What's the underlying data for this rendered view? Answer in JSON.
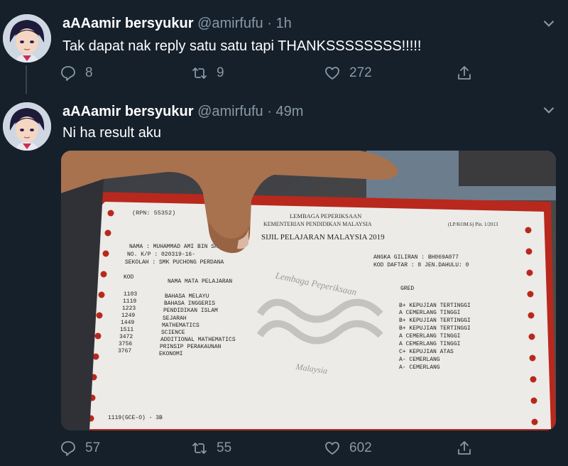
{
  "tweets": [
    {
      "name": "aAAamir bersyukur",
      "handle": "@amirfufu",
      "sep": "·",
      "time": "1h",
      "text": "Tak dapat nak reply satu satu tapi THANKSSSSSSSS!!!!!",
      "replies": "8",
      "retweets": "9",
      "likes": "272"
    },
    {
      "name": "aAAamir bersyukur",
      "handle": "@amirfufu",
      "sep": "·",
      "time": "49m",
      "text": "Ni ha result aku",
      "replies": "57",
      "retweets": "55",
      "likes": "602"
    }
  ],
  "slip": {
    "rpn": "(RPN: 55352)",
    "org1": "LEMBAGA PEPERIKSAAN",
    "org2": "KEMENTERIAN PENDIDIKAN MALAYSIA",
    "form": "(LP/KOM.6) Pin. 1/2013",
    "title": "SIJIL PELAJARAN MALAYSIA 2019",
    "nama": "NAMA   :  MUHAMMAD AMI          BIN SHAHARUDIN",
    "kp": "NO. K/P :  020319-16-",
    "sekolah": "SEKOLAH :  SMK PUCHONG PERDANA",
    "angka": "ANGKA GILIRAN  :  BH069A077",
    "daftar": "KOD DAFTAR  :  8 JEN.DAHULU:  0",
    "col_kod": "KOD",
    "col_nama": "NAMA MATA PELAJARAN",
    "col_gred": "GRED",
    "subjects": [
      {
        "kod": "1103",
        "nama": "BAHASA MELAYU",
        "gred": "B+  KEPUJIAN TERTINGGI"
      },
      {
        "kod": "1119",
        "nama": "BAHASA INGGERIS",
        "gred": "A   CEMERLANG TINGGI"
      },
      {
        "kod": "1223",
        "nama": "PENDIDIKAN ISLAM",
        "gred": "B+  KEPUJIAN TERTINGGI"
      },
      {
        "kod": "1249",
        "nama": "SEJARAH",
        "gred": "B+  KEPUJIAN TERTINGGI"
      },
      {
        "kod": "1449",
        "nama": "MATHEMATICS",
        "gred": "A   CEMERLANG TINGGI"
      },
      {
        "kod": "1511",
        "nama": "SCIENCE",
        "gred": "A   CEMERLANG TINGGI"
      },
      {
        "kod": "3472",
        "nama": "ADDITIONAL MATHEMATICS",
        "gred": "C+  KEPUJIAN ATAS"
      },
      {
        "kod": "3756",
        "nama": "PRINSIP PERAKAUNAN",
        "gred": "A-  CEMERLANG"
      },
      {
        "kod": "3767",
        "nama": "EKONOMI",
        "gred": "A-  CEMERLANG"
      }
    ],
    "footer": "1119(GCE-O)  -  3B",
    "watermark1": "Lembaga Peperiksaan",
    "watermark2": "Malaysia"
  }
}
